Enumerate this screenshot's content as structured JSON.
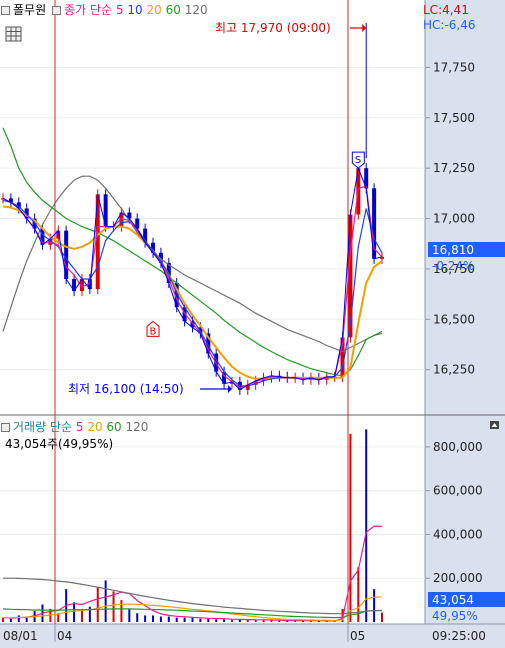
{
  "header": {
    "instrument": "폴무원",
    "price_label": "종가 단순",
    "ma_periods": [
      "5",
      "10",
      "20",
      "60",
      "120"
    ],
    "lc_text": "LC:4,41",
    "hc_text": "HC:-6,46"
  },
  "volume_header": {
    "label": "거래량 단순",
    "ma_periods": [
      "5",
      "20",
      "60",
      "120"
    ],
    "current_text": "43,054주(49,95%)"
  },
  "colors": {
    "price": "#0000ff",
    "ma5": "#e91e8c",
    "ma10": "#1e3fff",
    "ma20": "#f0a000",
    "ma60": "#1f9d1f",
    "ma120": "#707070",
    "up": "#e00000",
    "down": "#0000d0",
    "marker": "#e00000",
    "price_box": "#2060ff",
    "axis_bg": "#d9e1ee"
  },
  "chart_data": [
    {
      "type": "line",
      "title": "",
      "xlabel": "",
      "ylabel": "",
      "ylim": [
        16050,
        18000
      ],
      "y_ticks": [
        16250,
        16500,
        16750,
        17000,
        17250,
        17500,
        17750
      ],
      "y_tick_labels": [
        "16,250",
        "16,500",
        "16,750",
        "17,000",
        "17,250",
        "17,500",
        "17,750"
      ],
      "x_tick_labels": [
        "08/01",
        "04",
        "05",
        "09:25:00"
      ],
      "grid": true,
      "current_price": {
        "value": 16810,
        "label": "16,810",
        "change": "-0,24%"
      },
      "annotations": [
        {
          "kind": "high",
          "text": "최고 17,970 (09:00)",
          "value": 17970
        },
        {
          "kind": "low",
          "text": "최저 16,100 (14:50)",
          "value": 16100
        },
        {
          "kind": "buy",
          "text": "B",
          "value": 16480
        },
        {
          "kind": "sell",
          "text": "S",
          "value": 17290
        }
      ],
      "series": [
        {
          "name": "종가",
          "values": [
            17100,
            17080,
            17050,
            17000,
            16950,
            16870,
            16900,
            16940,
            16700,
            16640,
            16700,
            16650,
            17120,
            16960,
            16960,
            17030,
            17000,
            16950,
            16880,
            16830,
            16780,
            16680,
            16560,
            16490,
            16460,
            16430,
            16330,
            16240,
            16180,
            16190,
            16150,
            16175,
            16195,
            16210,
            16220,
            16215,
            16210,
            16210,
            16200,
            16210,
            16200,
            16215,
            16215,
            16410,
            17020,
            17250,
            17150,
            16800,
            16810
          ]
        },
        {
          "name": "5",
          "values": [
            17100,
            17080,
            17050,
            17000,
            16950,
            16880,
            16880,
            16870,
            16760,
            16720,
            16660,
            16680,
            16960,
            16960,
            16960,
            17000,
            16990,
            16940,
            16880,
            16830,
            16780,
            16700,
            16600,
            16530,
            16480,
            16430,
            16350,
            16280,
            16220,
            16190,
            16160,
            16175,
            16190,
            16205,
            16215,
            16215,
            16210,
            16210,
            16205,
            16205,
            16200,
            16210,
            16215,
            16380,
            16830,
            17150,
            17160,
            16850,
            16810
          ]
        },
        {
          "name": "10",
          "values": [
            17090,
            17080,
            17060,
            17020,
            16980,
            16920,
            16890,
            16860,
            16800,
            16750,
            16700,
            16700,
            16760,
            16890,
            16940,
            16980,
            16985,
            16950,
            16890,
            16840,
            16790,
            16720,
            16630,
            16560,
            16500,
            16440,
            16370,
            16300,
            16240,
            16200,
            16170,
            16170,
            16180,
            16195,
            16205,
            16210,
            16210,
            16210,
            16205,
            16205,
            16200,
            16210,
            16215,
            16260,
            16480,
            16860,
            17050,
            16900,
            16830
          ]
        },
        {
          "name": "20",
          "values": [
            17060,
            17055,
            17040,
            17015,
            16990,
            16950,
            16910,
            16880,
            16860,
            16850,
            16860,
            16880,
            16920,
            16950,
            16960,
            16960,
            16950,
            16920,
            16880,
            16840,
            16790,
            16720,
            16650,
            16580,
            16520,
            16470,
            16410,
            16360,
            16310,
            16265,
            16235,
            16215,
            16205,
            16205,
            16210,
            16210,
            16210,
            16210,
            16210,
            16210,
            16210,
            16210,
            16210,
            16210,
            16260,
            16480,
            16680,
            16760,
            16790
          ]
        },
        {
          "name": "60",
          "values": [
            17450,
            17360,
            17250,
            17180,
            17130,
            17090,
            17060,
            17030,
            17000,
            16980,
            16960,
            16945,
            16930,
            16910,
            16890,
            16865,
            16840,
            16815,
            16790,
            16765,
            16740,
            16710,
            16680,
            16650,
            16620,
            16590,
            16560,
            16530,
            16495,
            16465,
            16435,
            16410,
            16385,
            16360,
            16340,
            16320,
            16300,
            16285,
            16270,
            16255,
            16245,
            16235,
            16225,
            16220,
            16250,
            16320,
            16400,
            16420,
            16440
          ]
        },
        {
          "name": "120",
          "values": [
            16440,
            16560,
            16680,
            16790,
            16880,
            16970,
            17040,
            17100,
            17150,
            17190,
            17210,
            17210,
            17190,
            17150,
            17100,
            17050,
            16990,
            16930,
            16880,
            16840,
            16800,
            16770,
            16745,
            16720,
            16700,
            16680,
            16660,
            16640,
            16620,
            16600,
            16580,
            16555,
            16530,
            16510,
            16490,
            16470,
            16450,
            16435,
            16420,
            16405,
            16390,
            16370,
            16355,
            16340,
            16360,
            16380,
            16400,
            16420,
            16430
          ]
        }
      ]
    },
    {
      "type": "bar",
      "title": "",
      "xlabel": "",
      "ylabel": "",
      "ylim": [
        0,
        900000
      ],
      "y_ticks": [
        200000,
        400000,
        600000,
        800000
      ],
      "y_tick_labels": [
        "200,000",
        "400,000",
        "600,000",
        "800,000"
      ],
      "current_volume": {
        "value": 43054,
        "label": "43,054",
        "ratio": "49,95%"
      },
      "series": [
        {
          "name": "거래량",
          "values": [
            20000,
            15000,
            30000,
            25000,
            50000,
            80000,
            60000,
            40000,
            150000,
            90000,
            60000,
            70000,
            160000,
            190000,
            140000,
            100000,
            60000,
            40000,
            30000,
            30000,
            25000,
            25000,
            20000,
            20000,
            18000,
            15000,
            15000,
            12000,
            12000,
            10000,
            10000,
            10000,
            8000,
            8000,
            8000,
            6000,
            6000,
            6000,
            5000,
            5000,
            5000,
            5000,
            5000,
            60000,
            860000,
            250000,
            880000,
            150000,
            43054
          ]
        },
        {
          "name": "5",
          "values": [
            20000,
            18000,
            20000,
            22000,
            28000,
            40000,
            49000,
            53000,
            76000,
            84000,
            80000,
            94000,
            106000,
            114000,
            124000,
            136000,
            130000,
            98000,
            74000,
            52000,
            37000,
            30000,
            26000,
            24000,
            21000,
            19000,
            17000,
            16000,
            15000,
            13000,
            12000,
            11000,
            10000,
            10000,
            9000,
            8000,
            7000,
            7000,
            6000,
            6000,
            6000,
            5000,
            5000,
            16000,
            187000,
            237000,
            410000,
            438000,
            437000
          ]
        },
        {
          "name": "20",
          "values": [
            20000,
            20000,
            21000,
            22000,
            24000,
            28000,
            32000,
            36000,
            45000,
            50000,
            53000,
            56000,
            63000,
            72000,
            78000,
            81000,
            82000,
            81000,
            79000,
            76000,
            73000,
            70000,
            66000,
            62000,
            58000,
            55000,
            51000,
            47000,
            42000,
            37000,
            33000,
            28000,
            24000,
            20000,
            17000,
            14000,
            12000,
            11000,
            10000,
            9000,
            8000,
            8000,
            7000,
            10000,
            52000,
            64000,
            106000,
            113000,
            115000
          ]
        },
        {
          "name": "60",
          "values": [
            60000,
            58000,
            57000,
            56000,
            55000,
            55000,
            54000,
            54000,
            55000,
            56000,
            56000,
            57000,
            58000,
            59000,
            60000,
            60000,
            60000,
            59000,
            58000,
            57000,
            56000,
            55000,
            54000,
            52000,
            50000,
            49000,
            47000,
            45000,
            43000,
            41000,
            39000,
            37000,
            35000,
            33000,
            31000,
            29000,
            27000,
            25000,
            24000,
            23000,
            22000,
            21000,
            20000,
            21000,
            33000,
            37000,
            50000,
            52000,
            52000
          ]
        },
        {
          "name": "120",
          "values": [
            200000,
            200000,
            199000,
            198000,
            196000,
            194000,
            191000,
            187000,
            183000,
            178000,
            172000,
            166000,
            159000,
            152000,
            145000,
            138000,
            131000,
            124000,
            117000,
            111000,
            105000,
            99000,
            94000,
            89000,
            84000,
            80000,
            76000,
            72000,
            68000,
            65000,
            62000,
            59000,
            56000,
            53000,
            51000,
            49000,
            47000,
            45000,
            43000,
            41000,
            40000,
            39000,
            38000,
            38000,
            42000,
            44000,
            50000,
            52000,
            53000
          ]
        }
      ]
    }
  ]
}
